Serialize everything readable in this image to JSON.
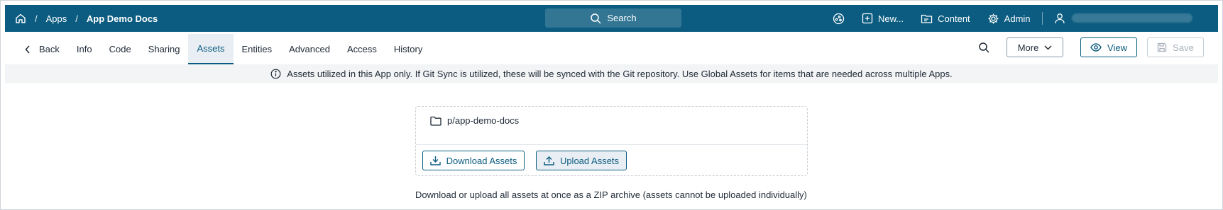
{
  "header": {
    "breadcrumb": [
      "Apps",
      "App Demo Docs"
    ],
    "search_label": "Search",
    "nav": [
      {
        "label": "",
        "icon": "help-icon"
      },
      {
        "label": "New...",
        "icon": "plus-square-icon"
      },
      {
        "label": "Content",
        "icon": "content-icon"
      },
      {
        "label": "Admin",
        "icon": "gear-icon"
      },
      {
        "label": "",
        "icon": "user-icon"
      }
    ]
  },
  "tabs": {
    "back_label": "Back",
    "items": [
      "Info",
      "Code",
      "Sharing",
      "Assets",
      "Entities",
      "Advanced",
      "Access",
      "History"
    ],
    "active": "Assets"
  },
  "toolbar": {
    "more_label": "More",
    "view_label": "View",
    "save_label": "Save"
  },
  "info_message": "Assets utilized in this App only. If Git Sync is utilized, these will be synced with the Git repository. Use Global Assets for items that are needed across multiple Apps.",
  "assets": {
    "folder_path": "p/app-demo-docs",
    "download_label": "Download Assets",
    "upload_label": "Upload Assets",
    "note": "Download or upload all assets at once as a ZIP archive (assets cannot be uploaded individually)"
  },
  "colors": {
    "brand": "#0b5c80",
    "info_bg": "#f3f4f5",
    "active_tab_bg": "#e8eef3"
  }
}
